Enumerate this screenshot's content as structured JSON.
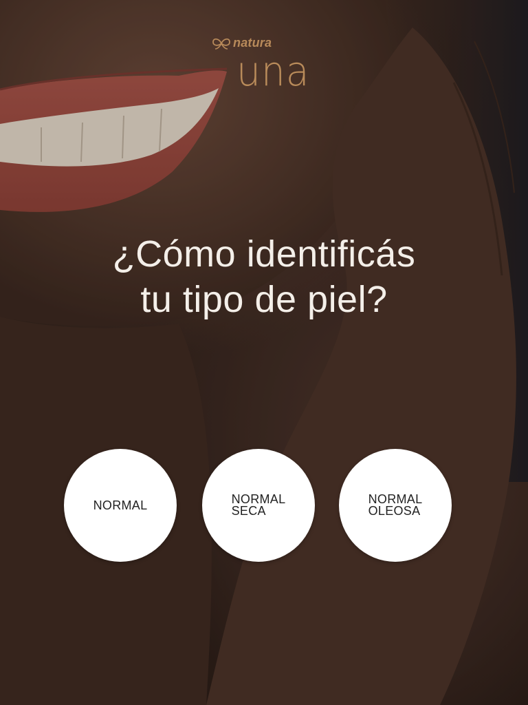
{
  "logo": {
    "brand": "natura",
    "line": "una",
    "icon": "natura-butterfly-icon"
  },
  "heading": {
    "line1": "¿Cómo identificás",
    "line2": "tu tipo de piel?"
  },
  "options": [
    {
      "line1": "NORMAL",
      "line2": ""
    },
    {
      "line1": "NORMAL",
      "line2": "SECA"
    },
    {
      "line1": "NORMAL",
      "line2": "OLEOSA"
    }
  ],
  "colors": {
    "logo_gold": "#b88a5a",
    "heading_text": "#f4efe9",
    "option_background": "#ffffff",
    "option_text": "#222222",
    "lips": "#b3554a"
  }
}
